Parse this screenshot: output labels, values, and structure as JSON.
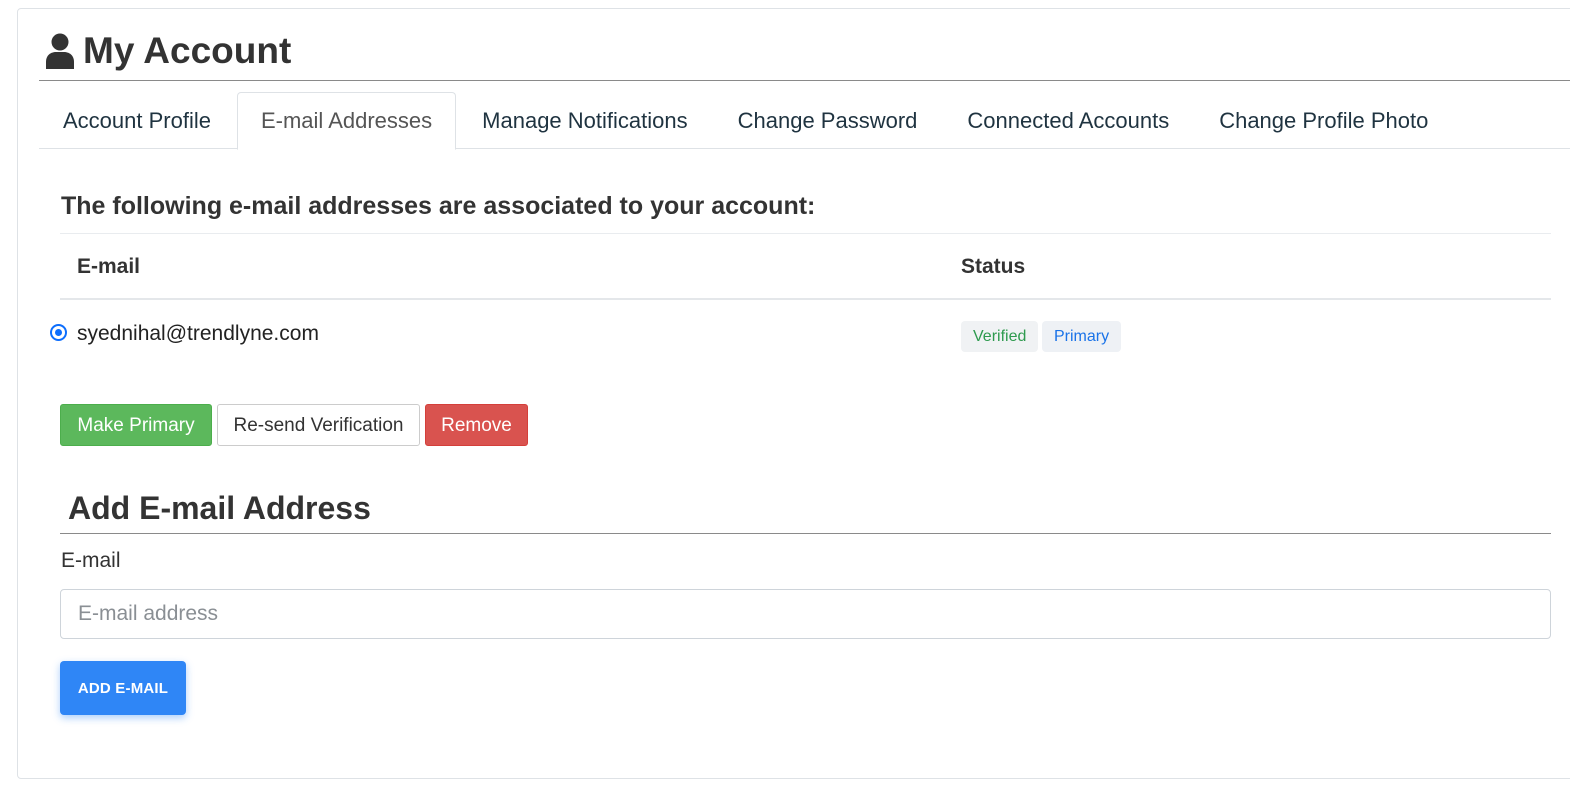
{
  "header": {
    "title": "My Account",
    "icon": "user-icon"
  },
  "tabs": [
    {
      "label": "Account Profile",
      "active": false
    },
    {
      "label": "E-mail Addresses",
      "active": true
    },
    {
      "label": "Manage Notifications",
      "active": false
    },
    {
      "label": "Change Password",
      "active": false
    },
    {
      "label": "Connected Accounts",
      "active": false
    },
    {
      "label": "Change Profile Photo",
      "active": false
    }
  ],
  "emails_section": {
    "heading": "The following e-mail addresses are associated to your account:",
    "columns": [
      "E-mail",
      "Status"
    ],
    "rows": [
      {
        "email": "syednihal@trendlyne.com",
        "selected": true,
        "badges": [
          "Verified",
          "Primary"
        ]
      }
    ]
  },
  "actions": {
    "make_primary": "Make Primary",
    "resend_verification": "Re-send Verification",
    "remove": "Remove"
  },
  "add_email": {
    "heading": "Add E-mail Address",
    "field_label": "E-mail",
    "placeholder": "E-mail address",
    "value": "",
    "submit_label": "ADD E-MAIL"
  },
  "colors": {
    "make_primary": "#5cb85c",
    "remove": "#d9534f",
    "add_button": "#2f86f6",
    "verified_text": "#2e9a4e",
    "primary_text": "#1a73e8",
    "radio": "#0d6efd"
  }
}
